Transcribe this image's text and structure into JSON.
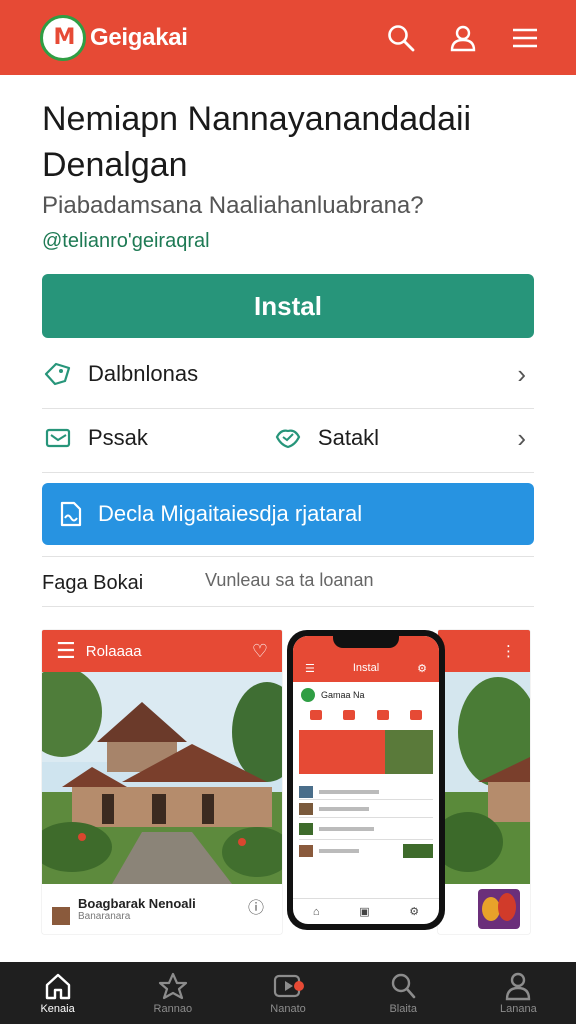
{
  "header": {
    "logo_text": "M",
    "brand": "Geigakai",
    "icons": [
      "search-icon",
      "user-icon",
      "menu-icon"
    ]
  },
  "app": {
    "title": "Nemiapn Nannayanandadaii Denalgan",
    "subtitle": "Piabadamsana Naaliahanluabrana?",
    "developer": "@telianro'geiraqral",
    "install_label": "Instal"
  },
  "rows": {
    "details_label": "Dalbnlonas",
    "share_label": "Pssak",
    "save_label": "Satakl",
    "promo_label": "Decla Migaitaiesdja rjataral"
  },
  "gallery": {
    "heading": "Faga Bokai",
    "subheading": "Vunleau sa ta loanan",
    "left_bar_title": "Rolaaaa",
    "left_caption": "Boagbarak Nenoali",
    "left_caption_sub": "Banaranara",
    "phone_title": "Instal",
    "phone_item": "Gamaa Na"
  },
  "bottom_nav": [
    {
      "label": "Kenaia",
      "icon": "home-icon",
      "active": true
    },
    {
      "label": "Rannao",
      "icon": "star-icon",
      "active": false
    },
    {
      "label": "Nanato",
      "icon": "play-icon",
      "active": false
    },
    {
      "label": "Blaita",
      "icon": "search-icon",
      "active": false
    },
    {
      "label": "Lanana",
      "icon": "account-icon",
      "active": false
    }
  ],
  "colors": {
    "brand_red": "#e64a35",
    "install_green": "#27957a",
    "promo_blue": "#2793e1",
    "nav_dark": "#1f1f1f"
  }
}
